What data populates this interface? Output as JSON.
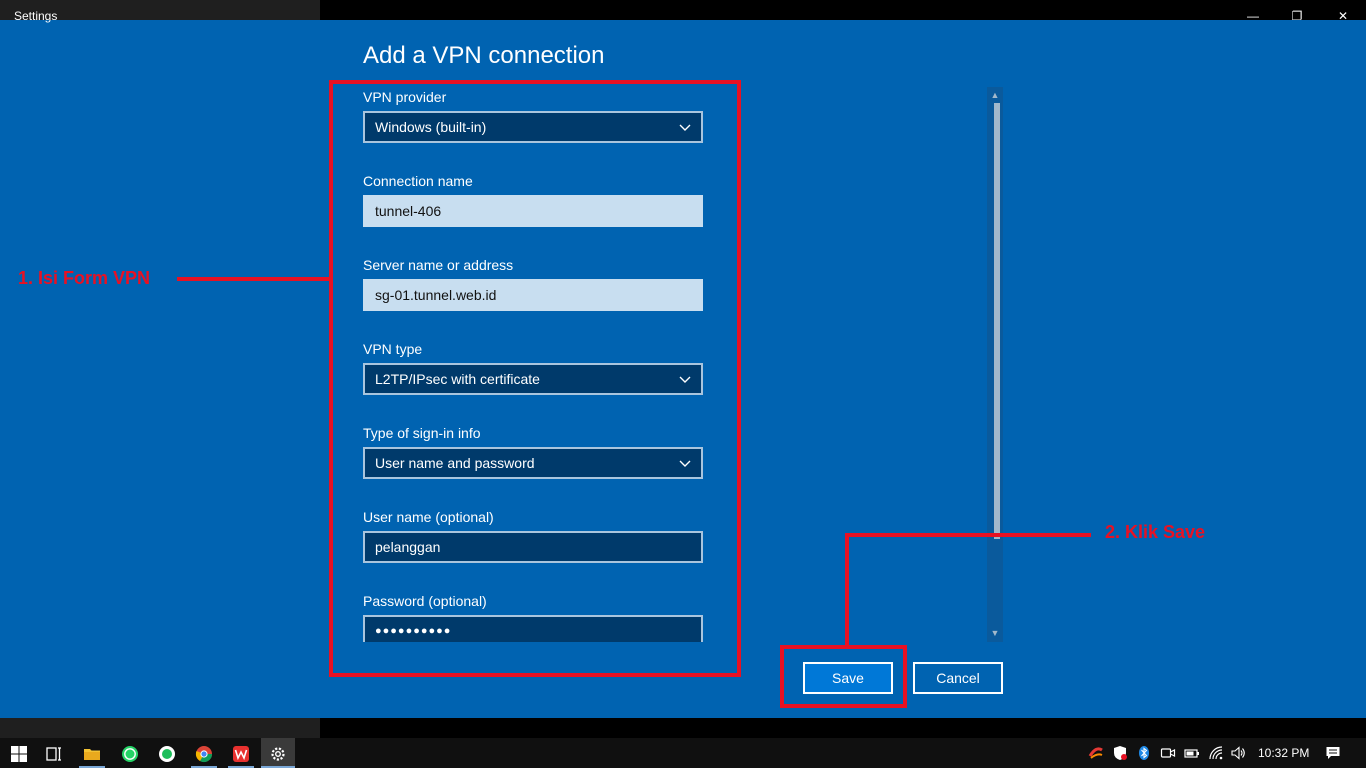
{
  "window": {
    "title": "Settings",
    "minimize_glyph": "—",
    "restore_glyph": "❐",
    "close_glyph": "✕"
  },
  "dialog": {
    "title": "Add a VPN connection",
    "fields": {
      "vpn_provider": {
        "label": "VPN provider",
        "value": "Windows (built-in)"
      },
      "connection_name": {
        "label": "Connection name",
        "value": "tunnel-406"
      },
      "server": {
        "label": "Server name or address",
        "value": "sg-01.tunnel.web.id"
      },
      "vpn_type": {
        "label": "VPN type",
        "value": "L2TP/IPsec with certificate"
      },
      "signin_type": {
        "label": "Type of sign-in info",
        "value": "User name and password"
      },
      "username": {
        "label": "User name (optional)",
        "value": "pelanggan"
      },
      "password": {
        "label": "Password (optional)",
        "value": "●●●●●●●●●●"
      }
    },
    "buttons": {
      "save": "Save",
      "cancel": "Cancel"
    }
  },
  "annotations": {
    "step1": "1. Isi Form VPN",
    "step2": "2. Klik Save"
  },
  "taskbar": {
    "apps": [
      "windows-start-icon",
      "task-view-icon",
      "file-explorer-icon",
      "whatsapp-icon",
      "whatsapp-desktop-icon",
      "chrome-icon",
      "wps-office-icon",
      "settings-icon"
    ],
    "tray": [
      "antivirus-icon",
      "shield-icon",
      "bluetooth-icon",
      "meet-now-icon",
      "battery-icon",
      "wifi-icon",
      "volume-icon"
    ],
    "time": "10:32 PM"
  },
  "colors": {
    "background": "#0063b1",
    "annotation": "#e81123",
    "save_button": "#0078d7"
  }
}
